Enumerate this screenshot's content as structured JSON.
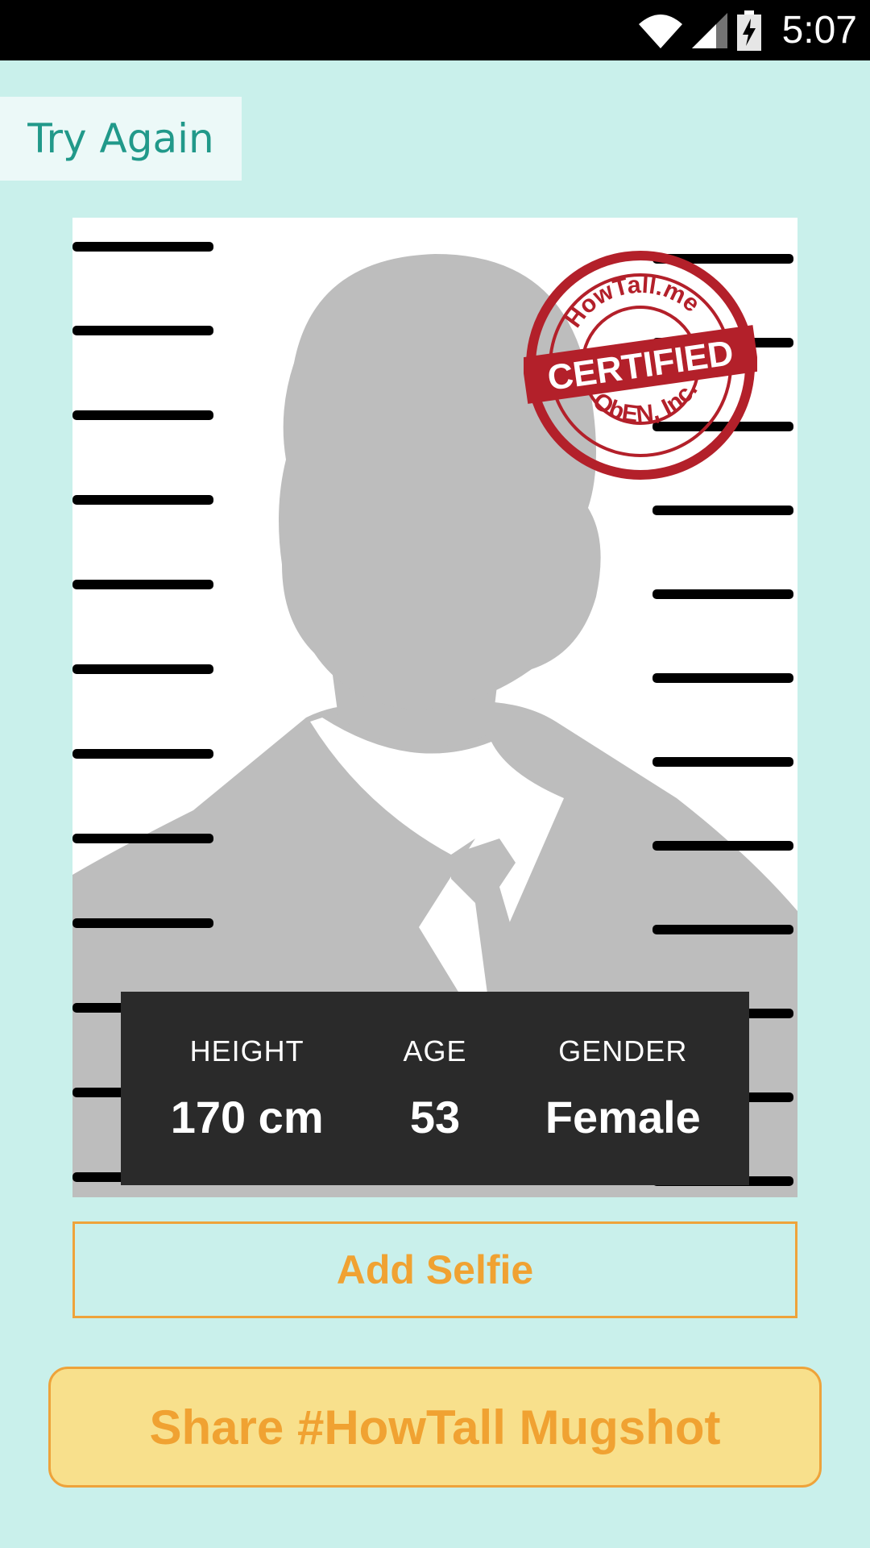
{
  "status_bar": {
    "time": "5:07",
    "icons": [
      "wifi-icon",
      "cell-signal-icon",
      "battery-charging-icon"
    ]
  },
  "try_again_label": "Try Again",
  "stamp": {
    "top_text": "HowTall.me",
    "center_text": "CERTIFIED",
    "bottom_text": "ObEN, Inc.",
    "color": "#b3202a"
  },
  "info": {
    "height_label": "HEIGHT",
    "height_value": "170 cm",
    "age_label": "AGE",
    "age_value": "53",
    "gender_label": "GENDER",
    "gender_value": "Female"
  },
  "buttons": {
    "add_selfie": "Add Selfie",
    "share": "Share #HowTall Mugshot"
  },
  "colors": {
    "background": "#c9f0eb",
    "accent": "#21998a",
    "orange": "#f0a232",
    "share_fill": "#f8e08c"
  }
}
